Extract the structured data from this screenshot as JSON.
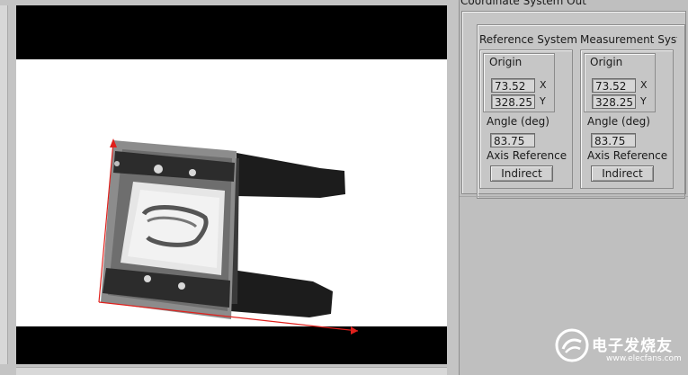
{
  "panel": {
    "title": "Coordinate System Out"
  },
  "reference": {
    "title": "Reference System",
    "origin_label": "Origin",
    "x_value": "73.52",
    "y_value": "328.25",
    "x_letter": "X",
    "y_letter": "Y",
    "angle_label": "Angle (deg)",
    "angle_value": "83.75",
    "axis_ref_label": "Axis Reference",
    "axis_ref_value": "Indirect"
  },
  "measurement": {
    "title": "Measurement Syste",
    "origin_label": "Origin",
    "x_value": "73.52",
    "y_value": "328.25",
    "x_letter": "X",
    "y_letter": "Y",
    "angle_label": "Angle (deg)",
    "angle_value": "83.75",
    "axis_ref_label": "Axis Reference",
    "axis_ref_value": "Indirect"
  },
  "watermark": {
    "text": "电子发烧友",
    "url": "www.elecfans.com"
  },
  "colors": {
    "axis_line": "#e0201c",
    "panel_bg": "#bfbfbf"
  }
}
